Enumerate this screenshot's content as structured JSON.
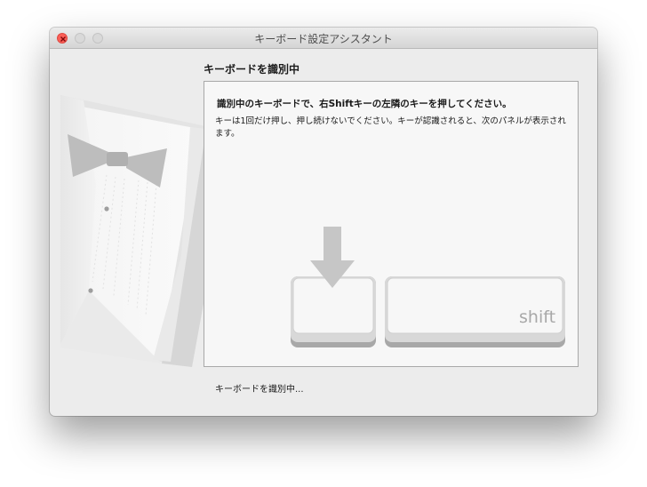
{
  "window": {
    "title": "キーボード設定アシスタント",
    "controls": {
      "close": "close-button",
      "minimize": "minimize-button",
      "zoom": "zoom-button"
    }
  },
  "main": {
    "heading": "キーボードを識別中",
    "instruction_title": "識別中のキーボードで、右Shiftキーの左隣のキーを押してください。",
    "instruction_body": "キーは1回だけ押し、押し続けないでください。キーが認識されると、次のパネルが表示されます。",
    "shift_key_label": "shift",
    "status": "キーボードを識別中..."
  },
  "icons": {
    "arrow": "down-arrow-icon",
    "illustration": "tuxedo-illustration"
  },
  "colors": {
    "close_button": "#fc5f57",
    "window_background": "#ececec",
    "panel_background": "#f7f7f7",
    "key_gray": "#a8a8a8"
  }
}
